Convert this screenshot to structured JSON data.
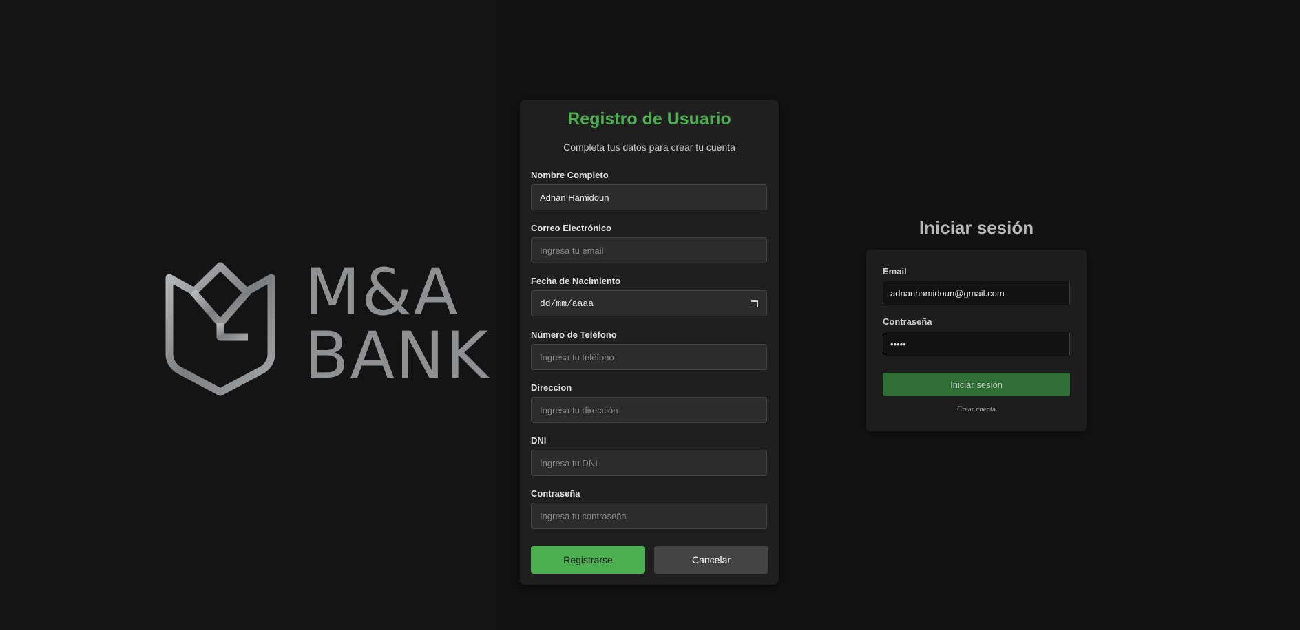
{
  "brand": {
    "line1": "M&A",
    "line2": "BANK"
  },
  "register": {
    "title": "Registro de Usuario",
    "subtitle": "Completa tus datos para crear tu cuenta",
    "fields": {
      "name": {
        "label": "Nombre Completo",
        "value": "Adnan Hamidoun",
        "placeholder": ""
      },
      "email": {
        "label": "Correo Electrónico",
        "value": "",
        "placeholder": "Ingresa tu email"
      },
      "birthdate": {
        "label": "Fecha de Nacimiento",
        "placeholder": "dd/mm/aaaa"
      },
      "phone": {
        "label": "Número de Teléfono",
        "value": "",
        "placeholder": "Ingresa tu teléfono"
      },
      "address": {
        "label": "Direccion",
        "value": "",
        "placeholder": "Ingresa tu dirección"
      },
      "dni": {
        "label": "DNI",
        "value": "",
        "placeholder": "Ingresa tu DNI"
      },
      "password": {
        "label": "Contraseña",
        "value": "",
        "placeholder": "Ingresa tu contraseña"
      }
    },
    "register_label": "Registrarse",
    "cancel_label": "Cancelar"
  },
  "login": {
    "title": "Iniciar sesión",
    "email_label": "Email",
    "email_value": "adnanhamidoun@gmail.com",
    "password_label": "Contraseña",
    "password_value": "•••••",
    "submit_label": "Iniciar sesión",
    "create_account_label": "Crear cuenta"
  },
  "colors": {
    "accent": "#4caf50",
    "login_button": "#2f6e35",
    "cancel_button": "#444444",
    "background": "#121212"
  },
  "icons": {
    "logo": "shield-crown-logo-icon",
    "date_picker": "calendar-icon"
  }
}
